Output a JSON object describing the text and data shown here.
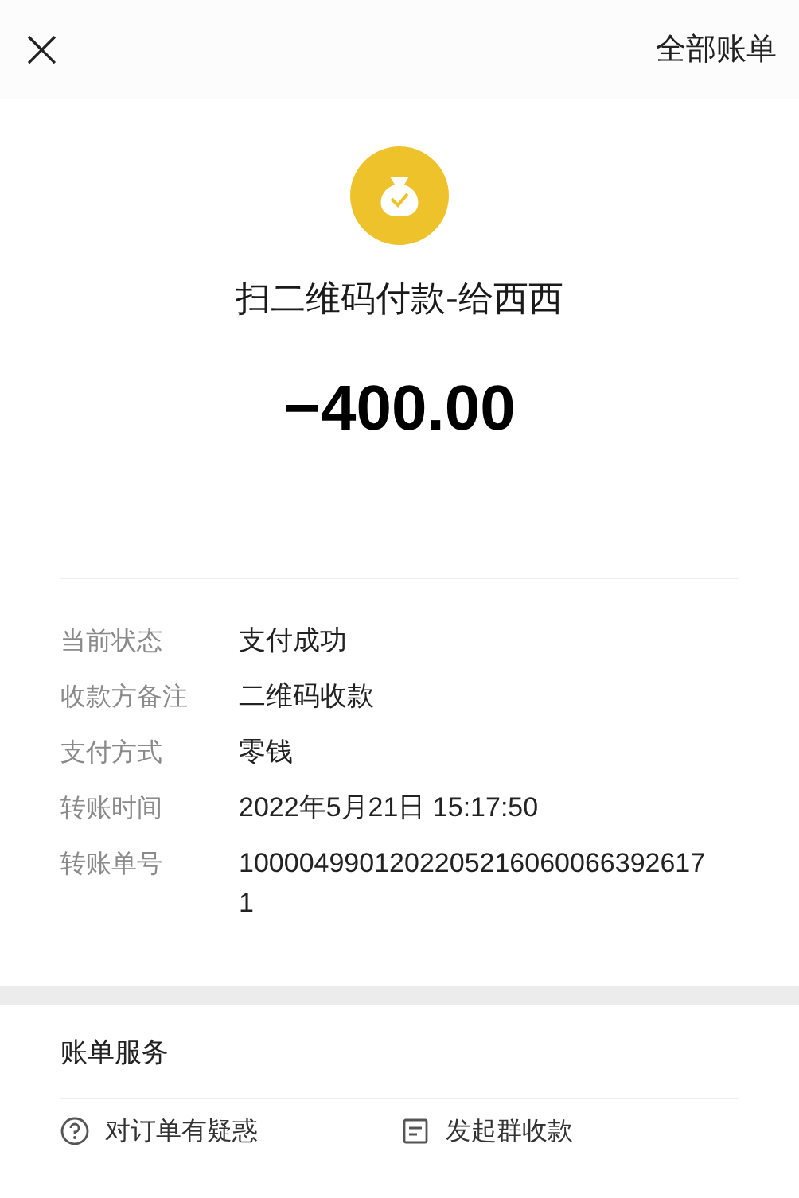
{
  "header": {
    "close": "×",
    "all_bills": "全部账单"
  },
  "title": "扫二维码付款-给西西",
  "amount": "−400.00",
  "details": [
    {
      "label": "当前状态",
      "value": "支付成功"
    },
    {
      "label": "收款方备注",
      "value": "二维码收款"
    },
    {
      "label": "支付方式",
      "value": "零钱"
    },
    {
      "label": "转账时间",
      "value": "2022年5月21日 15:17:50"
    },
    {
      "label": "转账单号",
      "value": "10000499012022052160600663926171"
    }
  ],
  "services": {
    "title": "账单服务",
    "actions": [
      "对订单有疑惑",
      "发起群收款"
    ]
  }
}
